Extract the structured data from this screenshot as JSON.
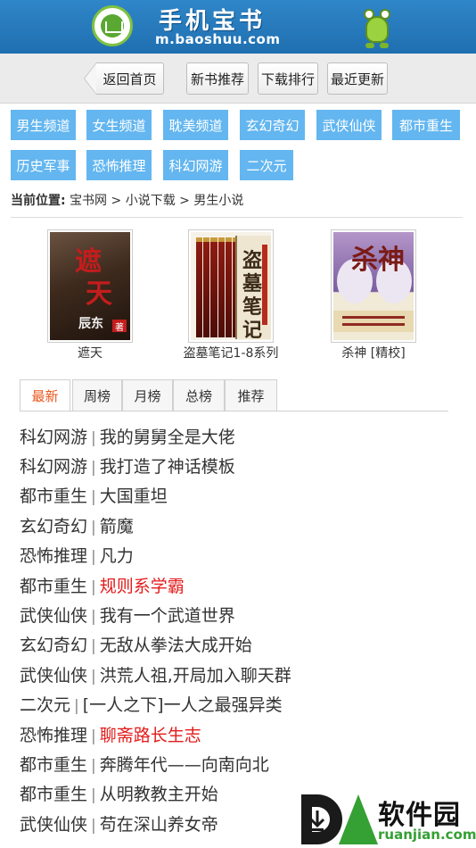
{
  "header": {
    "title": "手机宝书",
    "url": "m.baoshuu.com"
  },
  "nav": {
    "back": "返回首页",
    "new_books": "新书推荐",
    "downloads": "下载排行",
    "recent": "最近更新"
  },
  "categories": [
    "男生频道",
    "女生频道",
    "耽美频道",
    "玄幻奇幻",
    "武侠仙侠",
    "都市重生",
    "历史军事",
    "恐怖推理",
    "科幻网游",
    "二次元"
  ],
  "breadcrumb": {
    "label": "当前位置:",
    "path": "宝书网 > 小说下载 > 男生小说"
  },
  "featured": [
    {
      "caption": "遮天",
      "cover_title": "遮天",
      "cover_author": "辰东"
    },
    {
      "caption": "盗墓笔记1-8系列",
      "cover_title": "盗墓笔记"
    },
    {
      "caption": "杀神 [精校]",
      "cover_title": "杀神"
    }
  ],
  "tabs": [
    "最新",
    "周榜",
    "月榜",
    "总榜",
    "推荐"
  ],
  "active_tab": "最新",
  "list": [
    {
      "category": "科幻网游",
      "title": "我的舅舅全是大佬",
      "hot": false
    },
    {
      "category": "科幻网游",
      "title": "我打造了神话模板",
      "hot": false
    },
    {
      "category": "都市重生",
      "title": "大国重坦",
      "hot": false
    },
    {
      "category": "玄幻奇幻",
      "title": "箭魔",
      "hot": false
    },
    {
      "category": "恐怖推理",
      "title": "凡力",
      "hot": false
    },
    {
      "category": "都市重生",
      "title": "规则系学霸",
      "hot": true
    },
    {
      "category": "武侠仙侠",
      "title": "我有一个武道世界",
      "hot": false
    },
    {
      "category": "玄幻奇幻",
      "title": "无敌从拳法大成开始",
      "hot": false
    },
    {
      "category": "武侠仙侠",
      "title": "洪荒人祖,开局加入聊天群",
      "hot": false
    },
    {
      "category": "二次元",
      "title": "[一人之下]一人之最强异类",
      "hot": false
    },
    {
      "category": "恐怖推理",
      "title": "聊斋路长生志",
      "hot": true
    },
    {
      "category": "都市重生",
      "title": "奔腾年代——向南向北",
      "hot": false
    },
    {
      "category": "都市重生",
      "title": "从明教教主开始",
      "hot": false
    },
    {
      "category": "武侠仙侠",
      "title": "苟在深山养女帝",
      "hot": false
    }
  ],
  "watermark": {
    "name": "软件园",
    "url": "ruanjian.com"
  },
  "colors": {
    "header_blue": "#2a7dc0",
    "chip_blue": "#63b6f0",
    "tab_active": "#e8571b",
    "hot_red": "#e31b1b"
  }
}
